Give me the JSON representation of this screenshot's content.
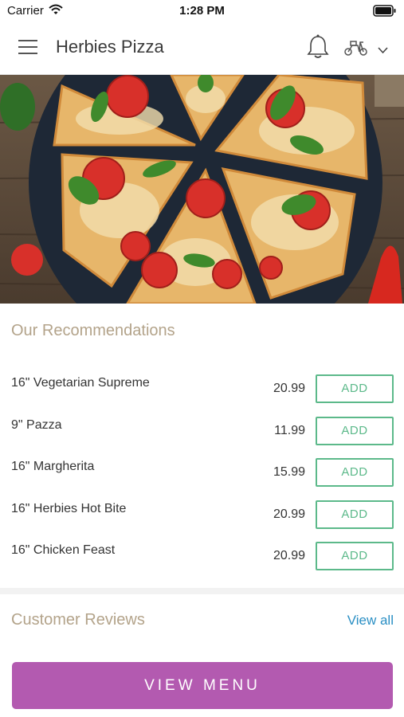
{
  "status_bar": {
    "carrier": "Carrier",
    "time": "1:28 PM"
  },
  "header": {
    "title": "Herbies Pizza"
  },
  "icons": {
    "menu": "hamburger-menu-icon",
    "notifications": "bell-icon",
    "delivery": "scooter-icon",
    "dropdown": "chevron-down-icon"
  },
  "hero": {
    "image": "pizza-slices-photo"
  },
  "recommendations": {
    "title": "Our Recommendations",
    "add_label": "ADD",
    "items": [
      {
        "name": "16\" Vegetarian Supreme",
        "price": "20.99"
      },
      {
        "name": "9\" Pazza",
        "price": "11.99"
      },
      {
        "name": "16\" Margherita",
        "price": "15.99"
      },
      {
        "name": "16\" Herbies Hot Bite",
        "price": "20.99"
      },
      {
        "name": "16\" Chicken Feast",
        "price": "20.99"
      }
    ]
  },
  "reviews": {
    "title": "Customer Reviews",
    "view_all": "View all"
  },
  "view_menu_button": "VIEW MENU",
  "colors": {
    "accent_gold": "#b3a38a",
    "add_green": "#5cb98a",
    "link_blue": "#2a8fc4",
    "menu_button": "#b35ab0"
  }
}
